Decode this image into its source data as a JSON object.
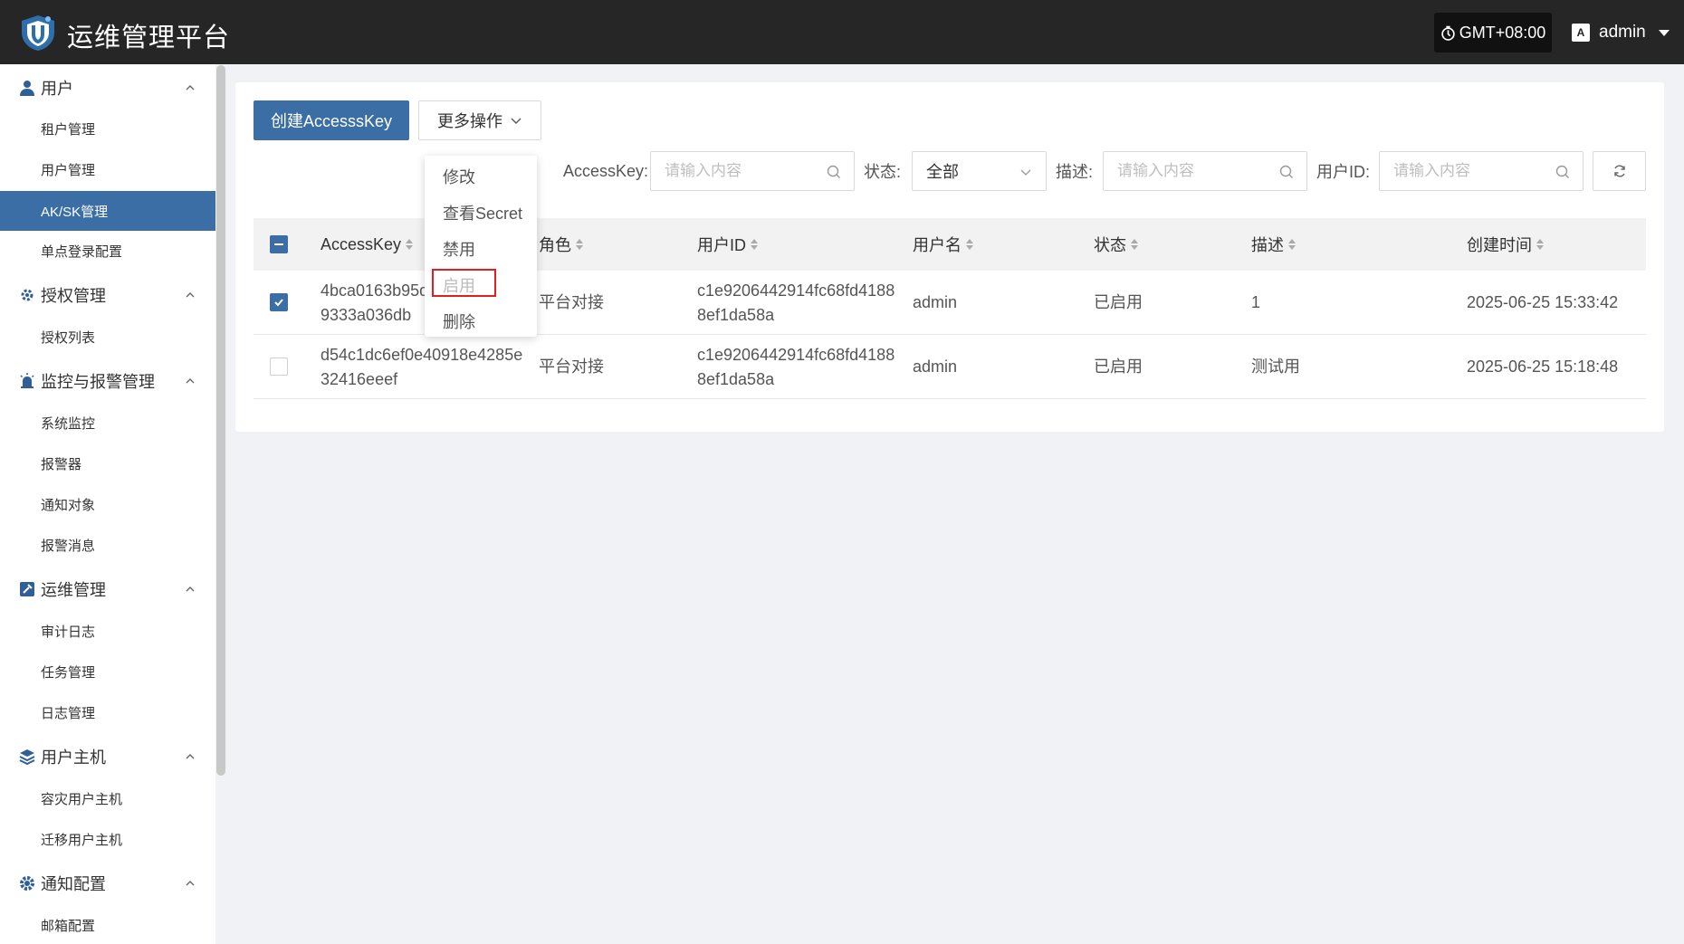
{
  "header": {
    "title": "运维管理平台",
    "timezone": "GMT+08:00",
    "user": "admin",
    "lang_icon_text": "A"
  },
  "sidebar": {
    "groups": [
      {
        "label": "用户",
        "icon": "user-icon",
        "items": [
          "租户管理",
          "用户管理",
          "AK/SK管理",
          "单点登录配置"
        ]
      },
      {
        "label": "授权管理",
        "icon": "gear-badge-icon",
        "items": [
          "授权列表"
        ]
      },
      {
        "label": "监控与报警管理",
        "icon": "alarm-icon",
        "items": [
          "系统监控",
          "报警器",
          "通知对象",
          "报警消息"
        ]
      },
      {
        "label": "运维管理",
        "icon": "tools-icon",
        "items": [
          "审计日志",
          "任务管理",
          "日志管理"
        ]
      },
      {
        "label": "用户主机",
        "icon": "layers-icon",
        "items": [
          "容灾用户主机",
          "迁移用户主机"
        ]
      },
      {
        "label": "通知配置",
        "icon": "cog-icon",
        "items": [
          "邮箱配置"
        ]
      }
    ],
    "active_item": "AK/SK管理"
  },
  "toolbar": {
    "create_label": "创建AccesssKey",
    "more_label": "更多操作"
  },
  "filters": {
    "accesskey_label": "AccessKey:",
    "accesskey_placeholder": "请输入内容",
    "status_label": "状态:",
    "status_value": "全部",
    "desc_label": "描述:",
    "desc_placeholder": "请输入内容",
    "userid_label": "用户ID:",
    "userid_placeholder": "请输入内容"
  },
  "dropdown": {
    "items": [
      "修改",
      "查看Secret",
      "禁用",
      "启用",
      "删除"
    ],
    "disabled_item": "启用"
  },
  "table": {
    "columns": [
      "AccessKey",
      "角色",
      "用户ID",
      "用户名",
      "状态",
      "描述",
      "创建时间"
    ],
    "rows": [
      {
        "checked": true,
        "accesskey_1": "4bca0163b95d",
        "accesskey_2": "9333a036db",
        "role": "平台对接",
        "userid_1": "c1e9206442914fc68fd4188",
        "userid_2": "8ef1da58a",
        "username": "admin",
        "status": "已启用",
        "desc": "1",
        "created": "2025-06-25 15:33:42"
      },
      {
        "checked": false,
        "accesskey_1": "d54c1dc6ef0e40918e4285e",
        "accesskey_2": "32416eeef",
        "role": "平台对接",
        "userid_1": "c1e9206442914fc68fd4188",
        "userid_2": "8ef1da58a",
        "username": "admin",
        "status": "已启用",
        "desc": "测试用",
        "created": "2025-06-25 15:18:48"
      }
    ]
  },
  "colors": {
    "primary": "#3a6ea5",
    "header_bg": "#262626",
    "highlight": "#e02020"
  }
}
